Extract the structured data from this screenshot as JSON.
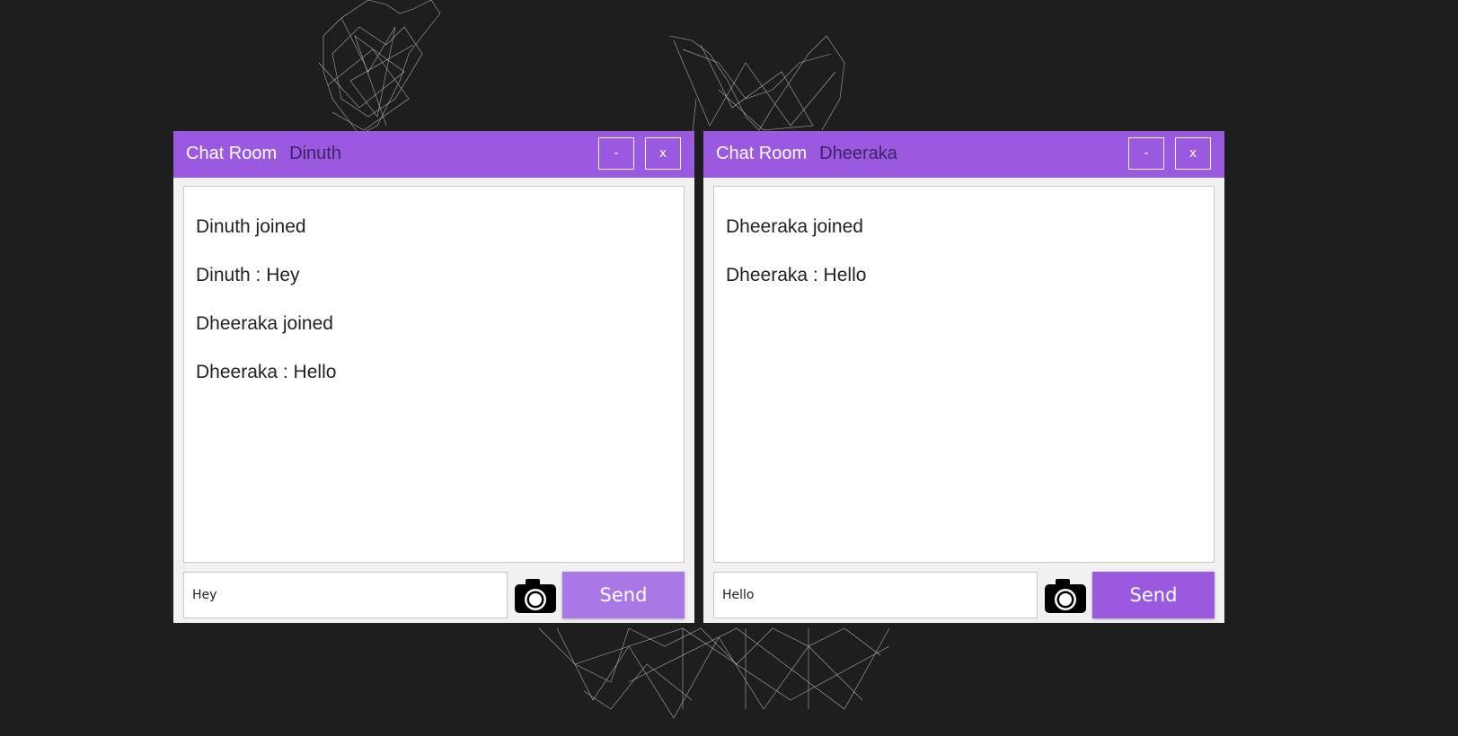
{
  "colors": {
    "background": "#1e1e1e",
    "titlebar": "#9b59e0",
    "title_user": "#3d2466",
    "send_button_left": "#a977e6",
    "send_button_right": "#9b59e0"
  },
  "icons": [
    "minimize-icon",
    "close-icon",
    "camera-icon"
  ],
  "windows": [
    {
      "title": "Chat Room",
      "user": "Dinuth",
      "minimize_label": "-",
      "close_label": "x",
      "messages": [
        "Dinuth joined",
        "Dinuth : Hey",
        "Dheeraka joined",
        "Dheeraka : Hello"
      ],
      "input_value": "Hey",
      "send_label": "Send"
    },
    {
      "title": "Chat Room",
      "user": "Dheeraka",
      "minimize_label": "-",
      "close_label": "x",
      "messages": [
        "Dheeraka joined",
        "Dheeraka : Hello"
      ],
      "input_value": "Hello",
      "send_label": "Send"
    }
  ]
}
